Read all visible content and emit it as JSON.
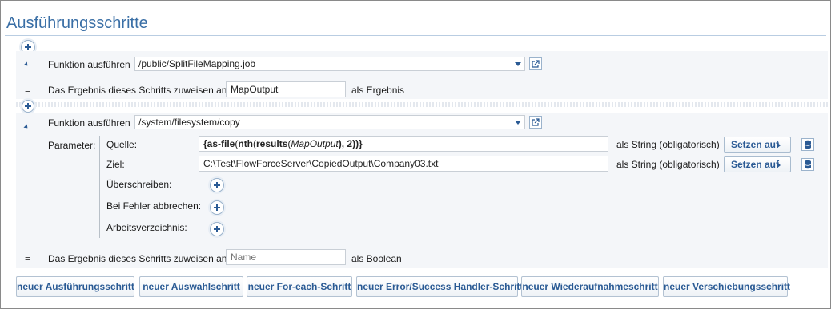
{
  "title": "Ausführungsschritte",
  "step1": {
    "exec_label": "Funktion ausführen",
    "function_value": "/public/SplitFileMapping.job",
    "assign_prefix": "=",
    "assign_label": "Das Ergebnis dieses Schritts zuweisen an",
    "assign_value": "MapOutput",
    "assign_suffix": "als Ergebnis"
  },
  "step2": {
    "exec_label": "Funktion ausführen",
    "function_value": "/system/filesystem/copy",
    "parameters_label": "Parameter:",
    "params": {
      "quelle_label": "Quelle:",
      "quelle_type": "als String (obligatorisch)",
      "ziel_label": "Ziel:",
      "ziel_value": "C:\\Test\\FlowForceServer\\CopiedOutput\\Company03.txt",
      "ziel_type": "als String (obligatorisch)",
      "ueberschreiben_label": "Überschreiben:",
      "bei_fehler_label": "Bei Fehler abbrechen:",
      "arbeitsverzeichnis_label": "Arbeitsverzeichnis:"
    },
    "set_button_label": "Setzen auf",
    "assign_prefix": "=",
    "assign_label": "Das Ergebnis dieses Schritts zuweisen an",
    "assign_placeholder": "Name",
    "assign_suffix": "als Boolean"
  },
  "expression": {
    "open": "{",
    "fn_asfile": "as-file",
    "p1": "(",
    "fn_nth": "nth",
    "p2": "(",
    "fn_results": "results",
    "p3": "(",
    "var": "MapOutput",
    "tail": "), 2))}"
  },
  "bottom_buttons": [
    "neuer Ausführungsschritt",
    "neuer Auswahlschritt",
    "neuer For-each-Schritt",
    "neuer Error/Success Handler-Schritt",
    "neuer Wiederaufnahmeschritt",
    "neuer Verschiebungsschritt"
  ],
  "colors": {
    "accent": "#2a5a94",
    "title": "#3a6fa6",
    "panel_bg": "#f4f6f9"
  },
  "icons": [
    "plus-icon",
    "collapse-triangle-icon",
    "dropdown-arrow-icon",
    "external-link-icon",
    "caret-right-icon",
    "database-icon"
  ]
}
